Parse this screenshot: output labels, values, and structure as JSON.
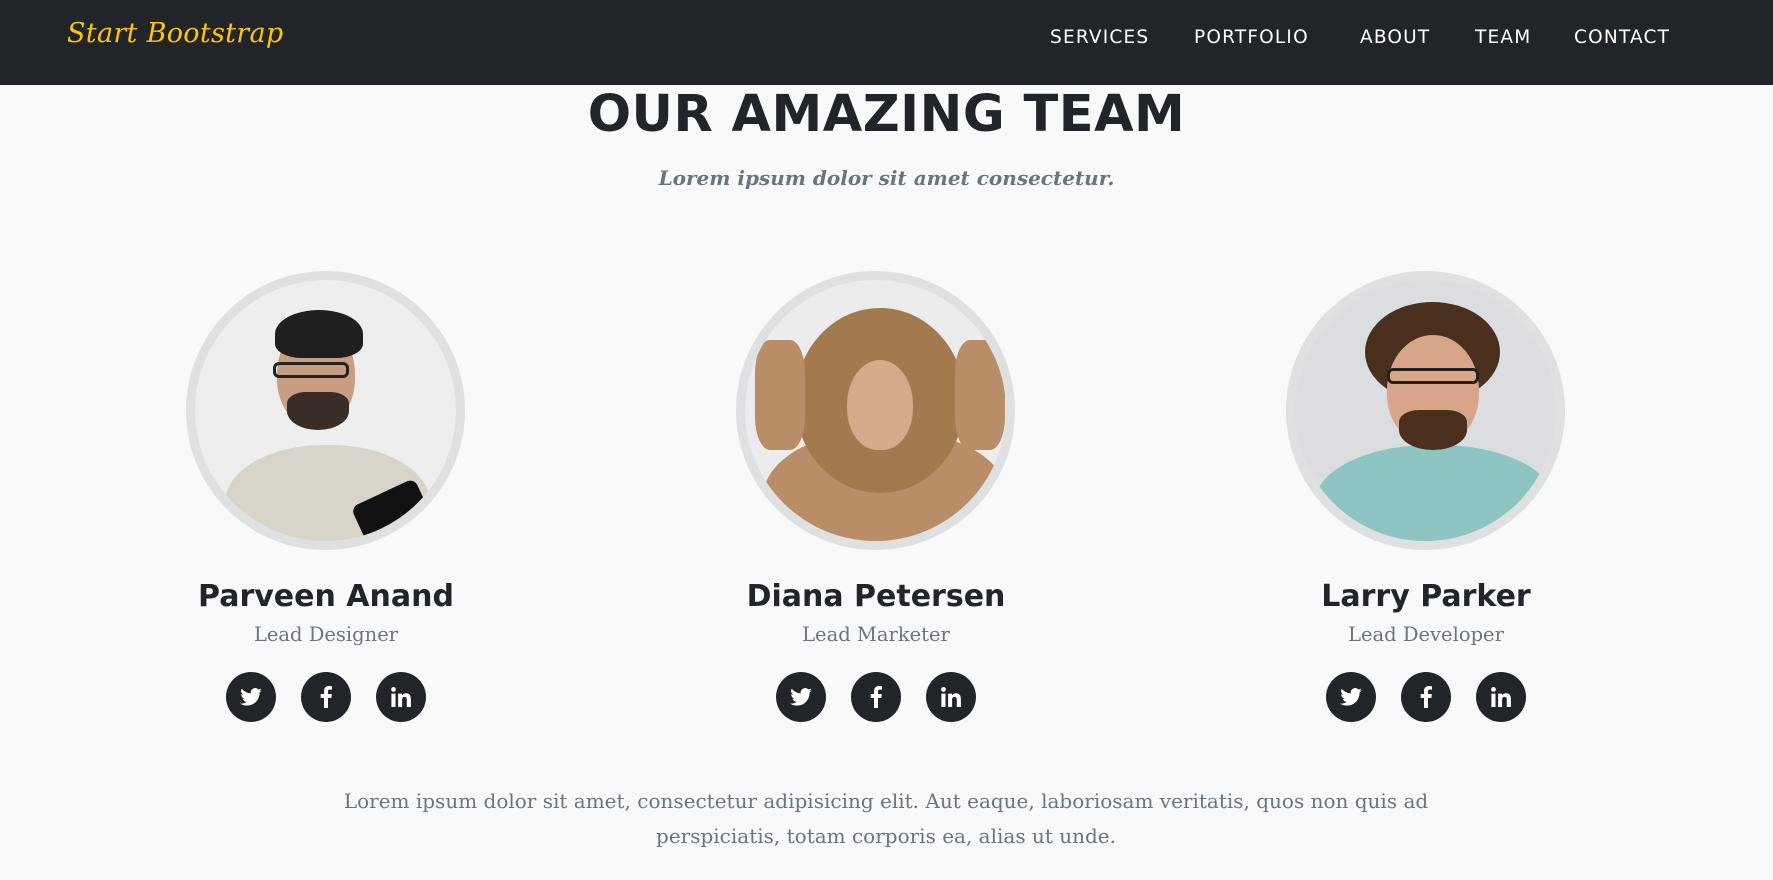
{
  "navbar": {
    "brand": "Start Bootstrap",
    "links": [
      "SERVICES",
      "PORTFOLIO",
      "ABOUT",
      "TEAM",
      "CONTACT"
    ]
  },
  "section": {
    "heading": "OUR AMAZING TEAM",
    "subheading": "Lorem ipsum dolor sit amet consectetur."
  },
  "team": [
    {
      "name": "Parveen Anand",
      "role": "Lead Designer"
    },
    {
      "name": "Diana Petersen",
      "role": "Lead Marketer"
    },
    {
      "name": "Larry Parker",
      "role": "Lead Developer"
    }
  ],
  "social_icons": [
    "twitter-icon",
    "facebook-icon",
    "linkedin-icon"
  ],
  "footer_text": "Lorem ipsum dolor sit amet, consectetur adipisicing elit. Aut eaque, laboriosam veritatis, quos non quis ad perspiciatis, totam corporis ea, alias ut unde.",
  "colors": {
    "navbar": "#212529",
    "brand": "#fec503",
    "heading": "#212529",
    "muted": "#6c757d",
    "background": "#f8f9fa"
  }
}
